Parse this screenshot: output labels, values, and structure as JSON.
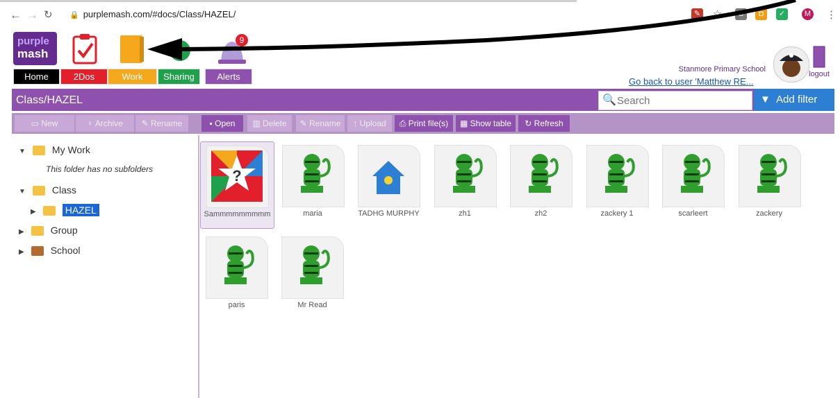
{
  "browser": {
    "url": "purplemash.com/#docs/Class/HAZEL/",
    "profile_initial": "M"
  },
  "app": {
    "logo_line1": "purple",
    "logo_line2": "mash",
    "alerts_count": "9",
    "tabs": [
      {
        "label": "Home",
        "color": "#000000"
      },
      {
        "label": "2Dos",
        "color": "#e2202c"
      },
      {
        "label": "Work",
        "color": "#f6a81c"
      },
      {
        "label": "Sharing",
        "color": "#1fa14c"
      },
      {
        "label": "Alerts",
        "color": "#8e51ad"
      }
    ],
    "school_name": "Stanmore Primary School",
    "go_back": "Go back to user 'Matthew RE...",
    "logout": "logout"
  },
  "pathbar": {
    "path": "Class/HAZEL",
    "search_placeholder": "Search",
    "filter_label": "Add filter"
  },
  "toolbar": {
    "left": [
      "New",
      "Archive",
      "Rename"
    ],
    "right": [
      "Open",
      "Delete",
      "Rename",
      "Upload",
      "Print file(s)",
      "Show table",
      "Refresh"
    ]
  },
  "tree": {
    "my_work": "My Work",
    "no_subfolders": "This folder has no subfolders",
    "class": "Class",
    "hazel": "HAZEL",
    "group": "Group",
    "school": "School"
  },
  "files": [
    {
      "name": "Sammmmmmmmm",
      "type": "quiz",
      "selected": true
    },
    {
      "name": "maria",
      "type": "monkey"
    },
    {
      "name": "TADHG MURPHY",
      "type": "house"
    },
    {
      "name": "zh1",
      "type": "monkey"
    },
    {
      "name": "zh2",
      "type": "monkey"
    },
    {
      "name": "zackery 1",
      "type": "monkey"
    },
    {
      "name": "scarleert",
      "type": "monkey"
    },
    {
      "name": "zackery",
      "type": "monkey"
    },
    {
      "name": "paris",
      "type": "monkey"
    },
    {
      "name": "Mr Read",
      "type": "monkey"
    }
  ],
  "colors": {
    "brand_purple": "#8e51ad",
    "filter_blue": "#2d7fd3",
    "selection_blue": "#1a66d6"
  }
}
